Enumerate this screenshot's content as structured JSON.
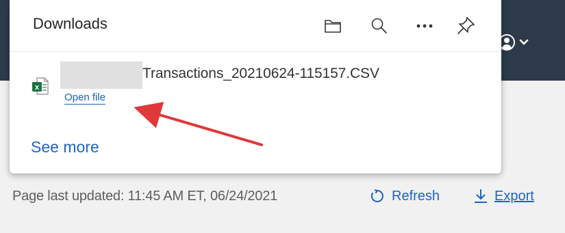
{
  "downloads": {
    "title": "Downloads",
    "icons": {
      "folder": "folder-icon",
      "search": "search-icon",
      "more": "more-options-icon",
      "pin": "pin-icon"
    },
    "items": [
      {
        "file_name": "Transactions_20210624-115157.CSV",
        "action_label": "Open file",
        "file_type_icon": "excel-file-icon"
      }
    ],
    "see_more": "See more"
  },
  "page": {
    "last_updated": "Page last updated: 11:45 AM ET, 06/24/2021",
    "refresh_label": "Refresh",
    "export_label": "Export"
  },
  "colors": {
    "link": "#1a63c3",
    "annotation_arrow": "#e0383b",
    "excel_green": "#1e7145"
  }
}
